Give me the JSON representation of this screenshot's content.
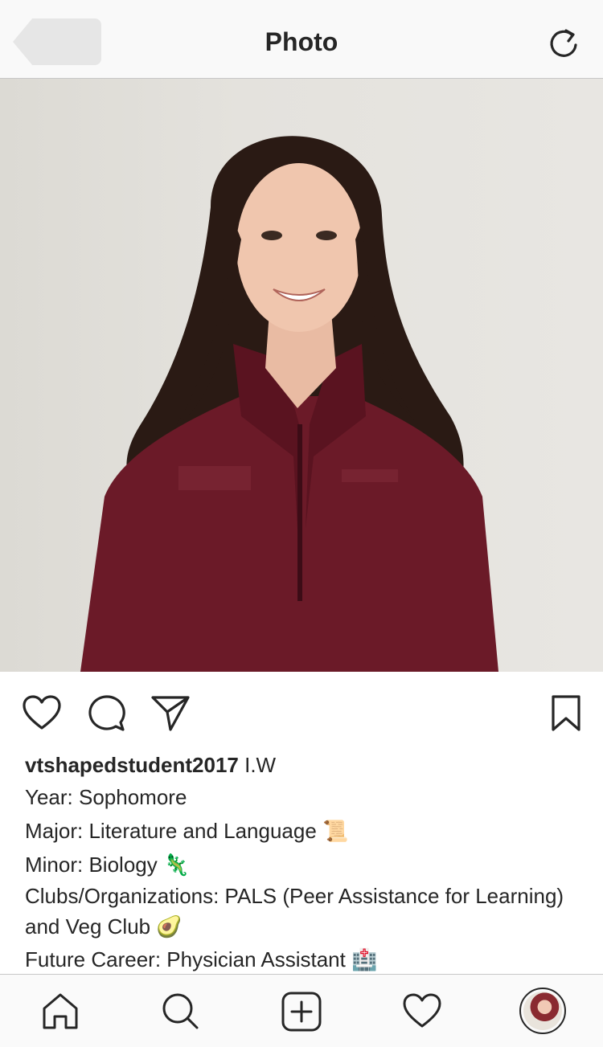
{
  "header": {
    "title": "Photo",
    "back_icon": "back-arrow-icon",
    "refresh_icon": "refresh-icon"
  },
  "post": {
    "actions": [
      "heart-icon",
      "comment-icon",
      "share-icon",
      "bookmark-icon"
    ],
    "caption": {
      "username": "vtshapedstudent2017",
      "suffix": " I.W",
      "year": "Year: Sophomore",
      "major": "Major: Literature and Language 📜",
      "minor": "Minor: Biology 🦎",
      "clubs": "Clubs/Organizations: PALS (Peer Assistance for Learning) and Veg Club 🥑",
      "career": "Future Career: Physician Assistant 🏥"
    }
  },
  "tabbar": {
    "items": [
      "home-icon",
      "search-icon",
      "add-post-icon",
      "activity-heart-icon",
      "profile-avatar"
    ]
  },
  "colors": {
    "background": "#ffffff",
    "bar": "#f9f9f9",
    "text": "#262626",
    "jacket": "#6b1a28"
  }
}
